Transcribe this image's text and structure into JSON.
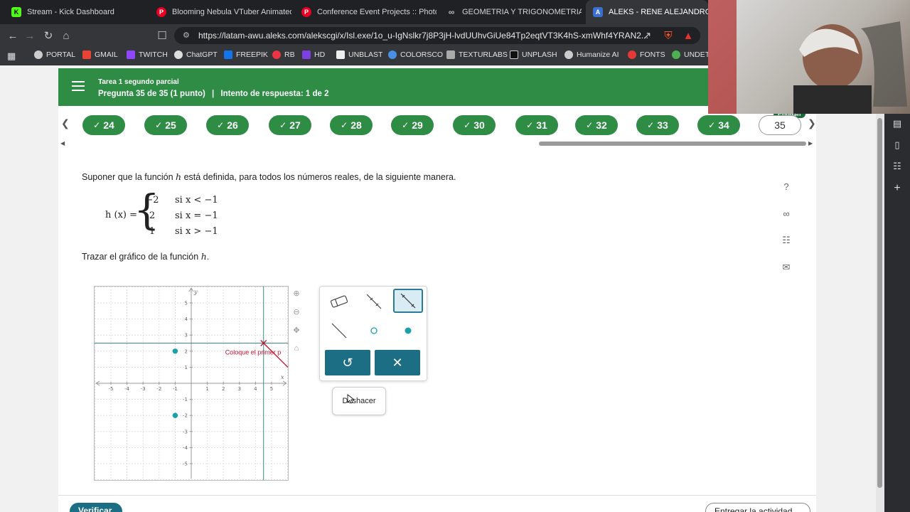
{
  "browser": {
    "tabs": [
      {
        "title": "Stream - Kick Dashboard",
        "icon": "kick-icon",
        "color": "#53fc18"
      },
      {
        "title": "Blooming Nebula VTuber Animated S",
        "icon": "pinterest-icon",
        "color": "#e60023"
      },
      {
        "title": "Conference Event Projects :: Photos, v",
        "icon": "pinterest-icon",
        "color": "#e60023"
      },
      {
        "title": "GEOMETRIA Y TRIGONOMETRIA (PR",
        "icon": "infinity-icon",
        "color": "#9aa0a6"
      },
      {
        "title": "ALEKS - RENE ALEJANDRO BOR.",
        "icon": "aleks-icon",
        "color": "#3b6fd1"
      }
    ],
    "url": "https://latam-awu.aleks.com/alekscgi/x/Isl.exe/1o_u-IgNslkr7j8P3jH-lvdUUhvGiUe84Tp2eqtVT3K4hS-xmWhf4YRAN2...",
    "bookmarks": [
      "PORTAL",
      "GMAIL",
      "TWITCH",
      "ChatGPT",
      "FREEPIK",
      "RB",
      "HD",
      "UNBLAST",
      "COLORSCO",
      "TEXTURLABS",
      "UNPLASH",
      "Humanize AI",
      "FONTS",
      "UNDETE"
    ]
  },
  "header": {
    "assignment": "Tarea 1 segundo parcial",
    "question_info": "Pregunta 35 de 35 (1 punto)",
    "separator": "|",
    "attempt_info": "Intento de respuesta: 1 de 2",
    "accent": "#2e8c45"
  },
  "question_nav": {
    "completed": [
      "24",
      "25",
      "26",
      "27",
      "28",
      "29",
      "30",
      "31",
      "32",
      "33",
      "34"
    ],
    "current": "35",
    "check": "✓",
    "language_tag": "English"
  },
  "problem": {
    "intro_before": "Suponer que la función ",
    "fn": "h",
    "intro_after": " está definida, para todos los números reales, de la siguiente manera.",
    "lhs": "h (x) =",
    "cases": [
      {
        "value": "−2",
        "condition": "si x < −1"
      },
      {
        "value": "2",
        "condition": "si x = −1"
      },
      {
        "value": "1",
        "condition": "si x > −1"
      }
    ],
    "instruction_before": "Trazar el gráfico de la función ",
    "instruction_fn": "h",
    "instruction_after": "."
  },
  "graph": {
    "x_label": "x",
    "y_label": "y",
    "x_ticks": [
      "-5",
      "-4",
      "-3",
      "-2",
      "-1",
      "1",
      "2",
      "3",
      "4",
      "5"
    ],
    "y_ticks": [
      "5",
      "4",
      "3",
      "2",
      "1",
      "-1",
      "-2",
      "-3",
      "-4",
      "-5"
    ],
    "range": [
      -5,
      5
    ],
    "points": [
      {
        "x": -1,
        "y": 2,
        "filled": true
      },
      {
        "x": -1,
        "y": -2,
        "filled": true
      }
    ],
    "cursor_point": {
      "x": 4.5,
      "y": 2.5
    },
    "hint_text": "Coloque el primer p",
    "point_color": "#1aa1a8",
    "hint_color": "#c8102e"
  },
  "palette": {
    "undo_symbol": "↺",
    "clear_symbol": "✕",
    "tooltip": "Deshacer",
    "button_color": "#1c6e85"
  },
  "footer": {
    "verify": "Verificar",
    "explain": "Entregar la actividad"
  }
}
